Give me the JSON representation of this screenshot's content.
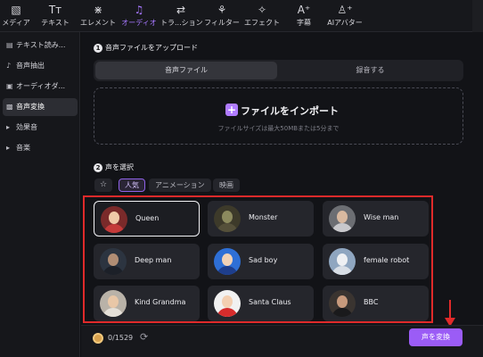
{
  "toolbar": {
    "items": [
      {
        "label": "メディア",
        "icon": "media-icon",
        "glyph": "▧"
      },
      {
        "label": "テキスト",
        "icon": "text-icon",
        "glyph": "Tт"
      },
      {
        "label": "エレメント",
        "icon": "element-icon",
        "glyph": "⋇"
      },
      {
        "label": "オーディオ",
        "icon": "audio-icon",
        "glyph": "♫"
      },
      {
        "label": "トラ...ション",
        "icon": "transition-icon",
        "glyph": "⇄"
      },
      {
        "label": "フィルター",
        "icon": "filter-icon",
        "glyph": "⚘"
      },
      {
        "label": "エフェクト",
        "icon": "effect-icon",
        "glyph": "✧"
      },
      {
        "label": "字幕",
        "icon": "caption-icon",
        "glyph": "A⁺"
      },
      {
        "label": "AIアバター",
        "icon": "ai-avatar-icon",
        "glyph": "♙⁺"
      }
    ],
    "active_index": 3,
    "accent_color": "#a777ff"
  },
  "sidebar": {
    "items": [
      {
        "label": "テキスト読み...",
        "icon": "text-to-speech-icon",
        "glyph": "▤"
      },
      {
        "label": "音声抽出",
        "icon": "microphone-icon",
        "glyph": "♪"
      },
      {
        "label": "オーディオダ...",
        "icon": "audio-duck-icon",
        "glyph": "▣"
      },
      {
        "label": "音声変換",
        "icon": "voice-change-icon",
        "glyph": "▩"
      },
      {
        "label": "効果音",
        "icon": "chevron-right-icon",
        "glyph": "▸"
      },
      {
        "label": "音楽",
        "icon": "chevron-right-icon",
        "glyph": "▸"
      }
    ],
    "active_index": 3
  },
  "upload": {
    "step": "1",
    "title": "音声ファイルをアップロード",
    "tabs": [
      "音声ファイル",
      "録音する"
    ],
    "active_tab": 0,
    "import_label": "ファイルをインポート",
    "hint": "ファイルサイズは最大50MBまたは5分まで"
  },
  "voices_section": {
    "step": "2",
    "title": "声を選択",
    "filters": [
      "人気",
      "アニメーション",
      "映画"
    ],
    "active_filter": 0,
    "voices": [
      {
        "name": "Queen",
        "selected": true
      },
      {
        "name": "Monster",
        "selected": false
      },
      {
        "name": "Wise man",
        "selected": false
      },
      {
        "name": "Deep man",
        "selected": false
      },
      {
        "name": "Sad boy",
        "selected": false
      },
      {
        "name": "female robot",
        "selected": false
      },
      {
        "name": "Kind Grandma",
        "selected": false
      },
      {
        "name": "Santa Claus",
        "selected": false
      },
      {
        "name": "BBC",
        "selected": false
      }
    ],
    "highlight_color": "#e02a2a"
  },
  "footer": {
    "credits": "0/1529",
    "convert_label": "声を変換",
    "convert_color": "#9b5cf6"
  }
}
